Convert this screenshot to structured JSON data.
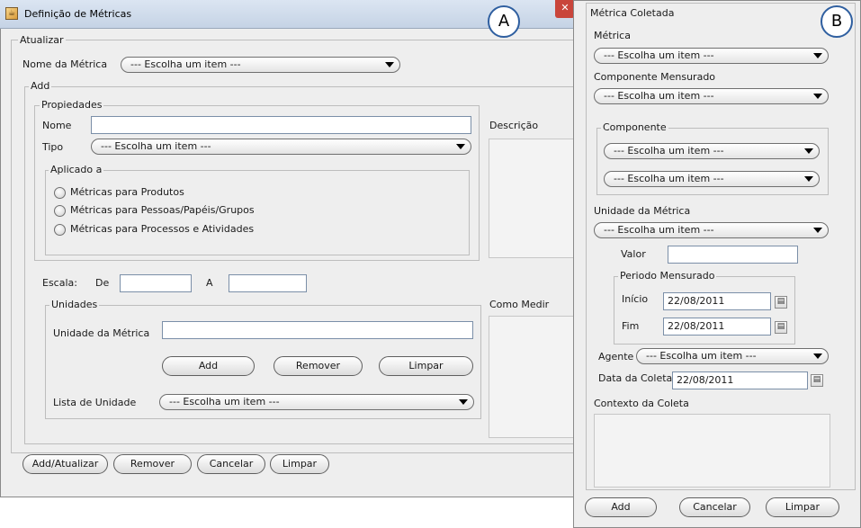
{
  "window_a": {
    "title": "Definição de Métricas",
    "close_label": "✕",
    "badge": "A",
    "atualizar": {
      "legend": "Atualizar",
      "metric_name_label": "Nome da Métrica",
      "metric_name_value": "--- Escolha um item ---"
    },
    "add": {
      "legend": "Add",
      "propiedades": {
        "legend": "Propiedades",
        "nome_label": "Nome",
        "nome_value": "",
        "tipo_label": "Tipo",
        "tipo_value": "--- Escolha um item ---",
        "aplicado": {
          "legend": "Aplicado a",
          "options": [
            "Métricas para Produtos",
            "Métricas para Pessoas/Papéis/Grupos",
            "Métricas para Processos e Atividades"
          ]
        }
      },
      "descricao_label": "Descrição",
      "escala": {
        "label": "Escala:",
        "de_label": "De",
        "de_value": "",
        "a_label": "A",
        "a_value": ""
      },
      "unidades": {
        "legend": "Unidades",
        "unidade_label": "Unidade da Métrica",
        "unidade_value": "",
        "add_label": "Add",
        "remover_label": "Remover",
        "limpar_label": "Limpar",
        "lista_label": "Lista de Unidade",
        "lista_value": "--- Escolha um item ---"
      },
      "como_medir_label": "Como Medir"
    },
    "footer": {
      "add_atualizar": "Add/Atualizar",
      "remover": "Remover",
      "cancelar": "Cancelar",
      "limpar": "Limpar"
    }
  },
  "window_b": {
    "badge": "B",
    "legend": "Métrica Coletada",
    "metrica_label": "Métrica",
    "metrica_value": "--- Escolha um item ---",
    "componente_mensurado_label": "Componente Mensurado",
    "componente_mensurado_value": "--- Escolha um item ---",
    "componente": {
      "legend": "Componente",
      "combo1": "--- Escolha um item ---",
      "combo2": "--- Escolha um item ---"
    },
    "unidade_label": "Unidade da Métrica",
    "unidade_value": "--- Escolha um item ---",
    "valor_label": "Valor",
    "valor_value": "",
    "periodo": {
      "legend": "Periodo Mensurado",
      "inicio_label": "Início",
      "inicio_value": "22/08/2011",
      "fim_label": "Fim",
      "fim_value": "22/08/2011"
    },
    "agente_label": "Agente",
    "agente_value": "--- Escolha um item ---",
    "data_coleta_label": "Data da Coleta",
    "data_coleta_value": "22/08/2011",
    "contexto_label": "Contexto da Coleta",
    "footer": {
      "add": "Add",
      "cancelar": "Cancelar",
      "limpar": "Limpar"
    }
  },
  "icons": {
    "calendar": "calendar-icon",
    "dropdown": "chevron-down-icon",
    "app": "java-cup-icon"
  },
  "colors": {
    "window_bg": "#eeeeee",
    "title_gradient_top": "#dbe5f2",
    "close_button": "#c9453b",
    "badge_border": "#2f5fa0"
  }
}
